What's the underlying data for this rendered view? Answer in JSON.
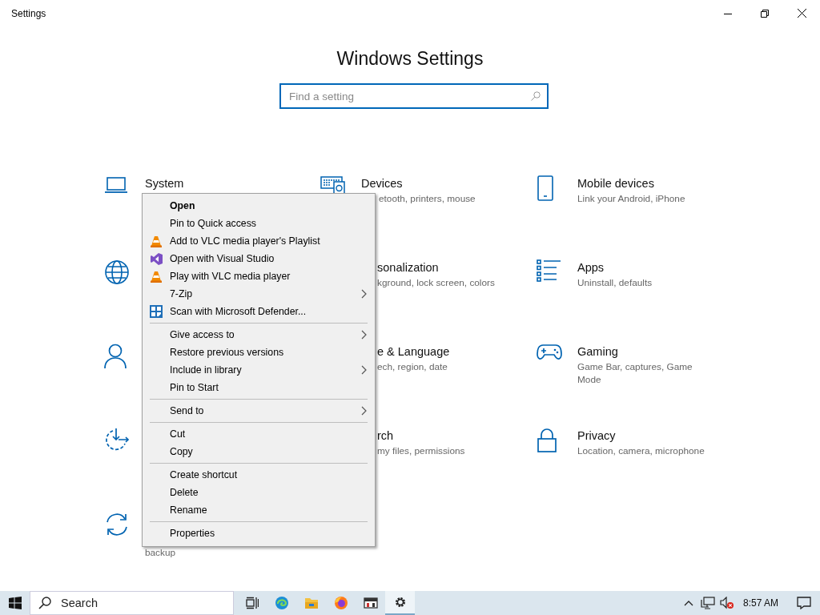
{
  "window": {
    "title": "Settings"
  },
  "heading": "Windows Settings",
  "search": {
    "placeholder": "Find a setting"
  },
  "tiles": [
    {
      "kind": "full",
      "title": "System"
    },
    {
      "kind": "description_cut",
      "title": "Devices",
      "description": "etooth, printers, mouse"
    },
    {
      "kind": "full",
      "title": "Mobile devices",
      "description": "Link your Android, iPhone"
    },
    {
      "kind": "icon_only"
    },
    {
      "kind": "partial",
      "title": "sonalization",
      "description": "kground, lock screen, colors"
    },
    {
      "kind": "full",
      "title": "Apps",
      "description": "Uninstall, defaults"
    },
    {
      "kind": "icon_only"
    },
    {
      "kind": "partial",
      "title": "e & Language",
      "description": "ech, region, date"
    },
    {
      "kind": "full",
      "title": "Gaming",
      "description": "Game Bar, captures, Game Mode"
    },
    {
      "kind": "icon_only"
    },
    {
      "kind": "partial",
      "title": "rch",
      "description": "my files, permissions"
    },
    {
      "kind": "full",
      "title": "Privacy",
      "description": "Location, camera, microphone"
    },
    {
      "kind": "second_line",
      "description": "backup"
    }
  ],
  "context_menu": [
    {
      "kind": "item",
      "label": "Open",
      "default": true,
      "submenu": false
    },
    {
      "kind": "item",
      "label": "Pin to Quick access",
      "default": false,
      "submenu": false
    },
    {
      "kind": "item",
      "label": "Add to VLC media player's Playlist",
      "default": false,
      "submenu": false
    },
    {
      "kind": "item",
      "label": "Open with Visual Studio",
      "default": false,
      "submenu": false
    },
    {
      "kind": "item",
      "label": "Play with VLC media player",
      "default": false,
      "submenu": false
    },
    {
      "kind": "item",
      "label": "7-Zip",
      "default": false,
      "submenu": true
    },
    {
      "kind": "item",
      "label": "Scan with Microsoft Defender...",
      "default": false,
      "submenu": false
    },
    {
      "kind": "separator"
    },
    {
      "kind": "item",
      "label": "Give access to",
      "default": false,
      "submenu": true
    },
    {
      "kind": "item",
      "label": "Restore previous versions",
      "default": false,
      "submenu": false
    },
    {
      "kind": "item",
      "label": "Include in library",
      "default": false,
      "submenu": true
    },
    {
      "kind": "item",
      "label": "Pin to Start",
      "default": false,
      "submenu": false
    },
    {
      "kind": "separator"
    },
    {
      "kind": "item",
      "label": "Send to",
      "default": false,
      "submenu": true
    },
    {
      "kind": "separator"
    },
    {
      "kind": "item",
      "label": "Cut",
      "default": false,
      "submenu": false
    },
    {
      "kind": "item",
      "label": "Copy",
      "default": false,
      "submenu": false
    },
    {
      "kind": "separator"
    },
    {
      "kind": "item",
      "label": "Create shortcut",
      "default": false,
      "submenu": false
    },
    {
      "kind": "item",
      "label": "Delete",
      "default": false,
      "submenu": false
    },
    {
      "kind": "item",
      "label": "Rename",
      "default": false,
      "submenu": false
    },
    {
      "kind": "separator"
    },
    {
      "kind": "item",
      "label": "Properties",
      "default": false,
      "submenu": false
    }
  ],
  "taskbar": {
    "search_placeholder": "Search",
    "apps": [
      {
        "selected": false
      },
      {
        "selected": false
      },
      {
        "selected": false
      },
      {
        "selected": false
      },
      {
        "selected": false
      },
      {
        "selected": true
      }
    ],
    "clock": "8:57 AM"
  }
}
